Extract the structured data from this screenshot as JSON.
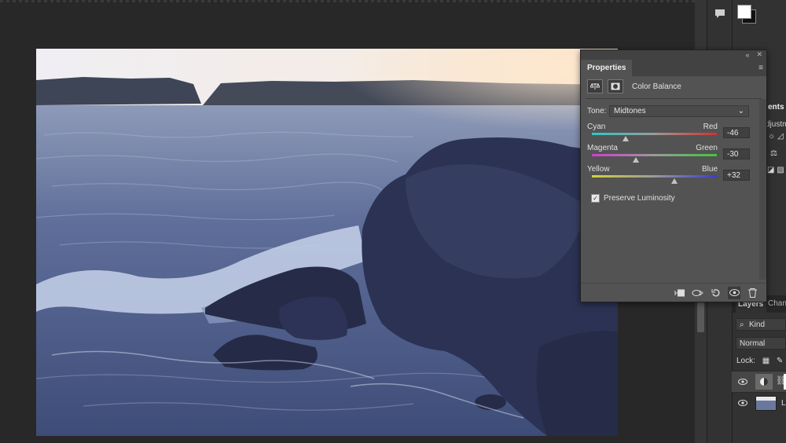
{
  "colors": {
    "app_bg": "#282828",
    "panel_bg": "#535353",
    "panel_header": "#424242",
    "dock_bg": "#323232"
  },
  "properties_panel": {
    "collapse_icon": "double-chevron-icon",
    "close_icon": "close-icon",
    "tab_label": "Properties",
    "menu_icon": "hamburger-icon",
    "adjustment_title": "Color Balance",
    "tone_label": "Tone:",
    "tone_value": "Midtones",
    "sliders": [
      {
        "left": "Cyan",
        "right": "Red",
        "value": "-46",
        "level": -46,
        "colors": [
          "#2fc7c7",
          "#d23232"
        ]
      },
      {
        "left": "Magenta",
        "right": "Green",
        "value": "-30",
        "level": -30,
        "colors": [
          "#d23cd2",
          "#3cc83c"
        ]
      },
      {
        "left": "Yellow",
        "right": "Blue",
        "value": "+32",
        "level": 32,
        "colors": [
          "#d2d23c",
          "#3c3cd2"
        ]
      }
    ],
    "preserve_luminosity": {
      "label": "Preserve Luminosity",
      "checked": true
    },
    "footer_icons": [
      "clip-to-layer-icon",
      "view-previous-icon",
      "reset-icon",
      "visibility-icon",
      "delete-icon"
    ]
  },
  "right_dock": {
    "partial_tab": "ents",
    "partial_adjustments": "djustme",
    "layers_tab": "Layers",
    "channels_tab": "Chann",
    "kind_label": "Kind",
    "blend_mode": "Normal",
    "lock_label": "Lock:",
    "layers": [
      {
        "name": "",
        "type": "adjustment"
      },
      {
        "name": "La",
        "type": "image"
      }
    ]
  }
}
